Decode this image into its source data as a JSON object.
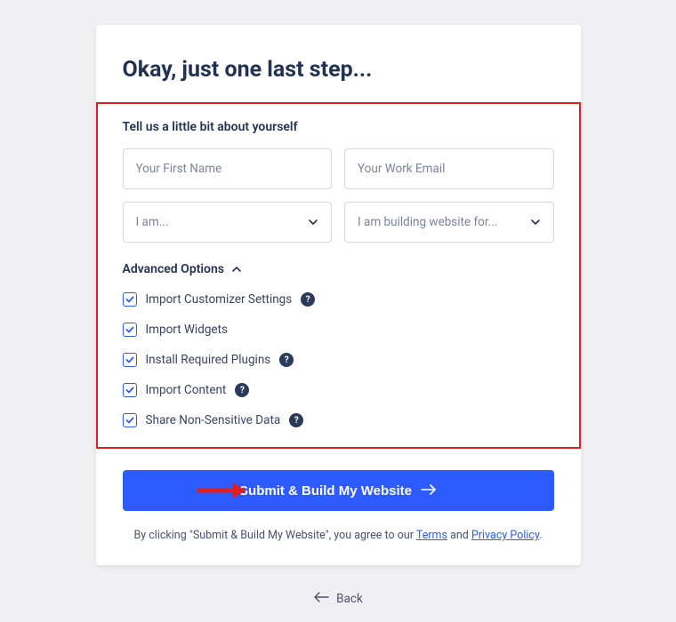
{
  "title": "Okay, just one last step...",
  "section_subtitle": "Tell us a little bit about yourself",
  "fields": {
    "first_name_placeholder": "Your First Name",
    "email_placeholder": "Your Work Email",
    "role_placeholder": "I am...",
    "building_placeholder": "I am building website for..."
  },
  "advanced_label": "Advanced Options",
  "options": [
    {
      "label": "Import Customizer Settings",
      "help": true
    },
    {
      "label": "Import Widgets",
      "help": false
    },
    {
      "label": "Install Required Plugins",
      "help": true
    },
    {
      "label": "Import Content",
      "help": true
    },
    {
      "label": "Share Non-Sensitive Data",
      "help": true
    }
  ],
  "submit_label": "Submit & Build My Website",
  "agree_prefix": "By clicking \"Submit & Build My Website\", you agree to our ",
  "terms_label": "Terms",
  "agree_mid": " and ",
  "privacy_label": "Privacy Policy",
  "agree_suffix": ".",
  "back_label": "Back",
  "help_glyph": "?"
}
